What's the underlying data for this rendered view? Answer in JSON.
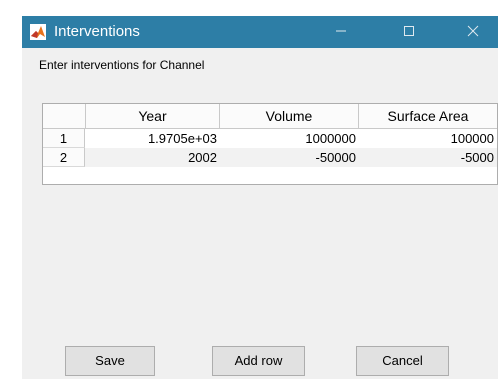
{
  "window": {
    "title": "Interventions",
    "controls": {
      "minimize": "—",
      "maximize": "☐",
      "close": "✕"
    }
  },
  "subtitle": "Enter interventions for Channel",
  "table": {
    "columns": [
      "",
      "Year",
      "Volume",
      "Surface Area"
    ],
    "rows": [
      {
        "index": "1",
        "year": "1.9705e+03",
        "volume": "1000000",
        "surface_area": "100000"
      },
      {
        "index": "2",
        "year": "2002",
        "volume": "-50000",
        "surface_area": "-5000"
      }
    ]
  },
  "buttons": {
    "save": "Save",
    "add_row": "Add row",
    "cancel": "Cancel"
  },
  "colors": {
    "titlebar": "#2d7ea6",
    "window_bg": "#f0f0f0"
  }
}
